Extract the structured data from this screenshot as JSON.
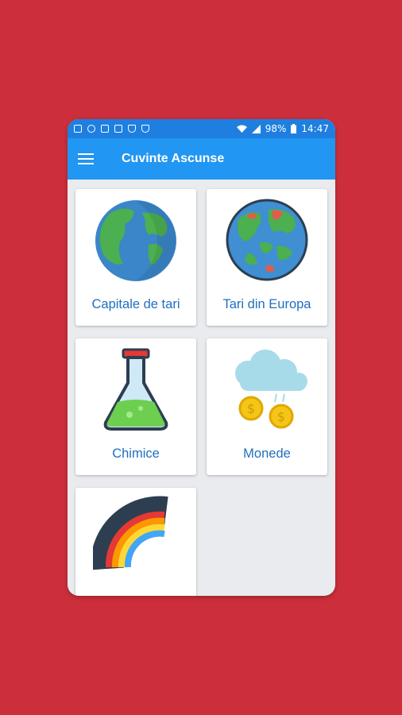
{
  "status_bar": {
    "battery": "98%",
    "time": "14:47"
  },
  "app_bar": {
    "title": "Cuvinte Ascunse",
    "menu_icon": "hamburger-menu-icon"
  },
  "categories": [
    {
      "label": "Capitale de tari",
      "icon": "globe-icon"
    },
    {
      "label": "Tari din Europa",
      "icon": "world-map-globe-icon"
    },
    {
      "label": "Chimice",
      "icon": "flask-icon"
    },
    {
      "label": "Monede",
      "icon": "coins-cloud-icon"
    },
    {
      "label": "",
      "icon": "rainbow-icon"
    }
  ],
  "colors": {
    "background": "#cc2f3b",
    "statusbar": "#1e7fe0",
    "appbar": "#2196f3",
    "label": "#1f6fbf"
  }
}
